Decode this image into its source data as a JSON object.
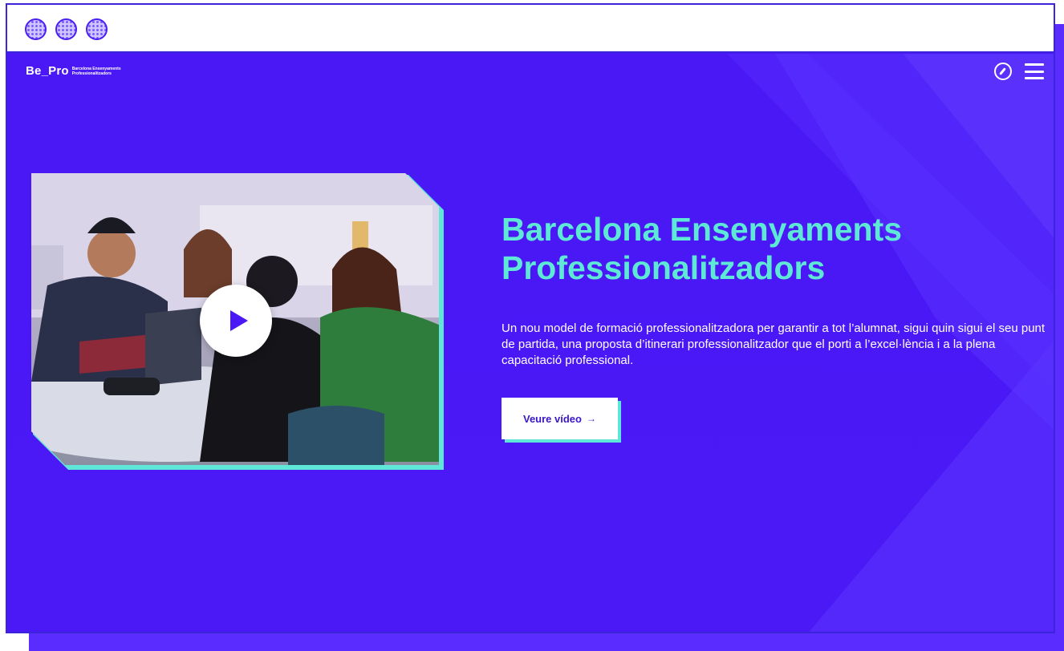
{
  "browser": {
    "buttons": [
      "window-control-1",
      "window-control-2",
      "window-control-3"
    ]
  },
  "header": {
    "logo_main": "Be_Pro",
    "logo_sub_line1": "Barcelona Ensenyaments",
    "logo_sub_line2": "Professionalitzadors",
    "icons": [
      "compass-icon",
      "hamburger-menu-icon"
    ]
  },
  "hero": {
    "title_line1": "Barcelona Ensenyaments",
    "title_line2": "Professionalitzadors",
    "description": "Un nou model de formació professionalitzadora per garantir a tot l’alumnat, sigui quin sigui el seu punt de partida, una proposta d’itinerari professionalitzador que el porti a l’excel·lència i a la plena capacitació professional.",
    "cta_label": "Veure vídeo",
    "cta_arrow": "→",
    "video_icon": "play-icon"
  },
  "colors": {
    "background": "#4a17f5",
    "accent": "#5ee8d6",
    "text": "#ffffff",
    "button_text": "#3a16c9"
  }
}
